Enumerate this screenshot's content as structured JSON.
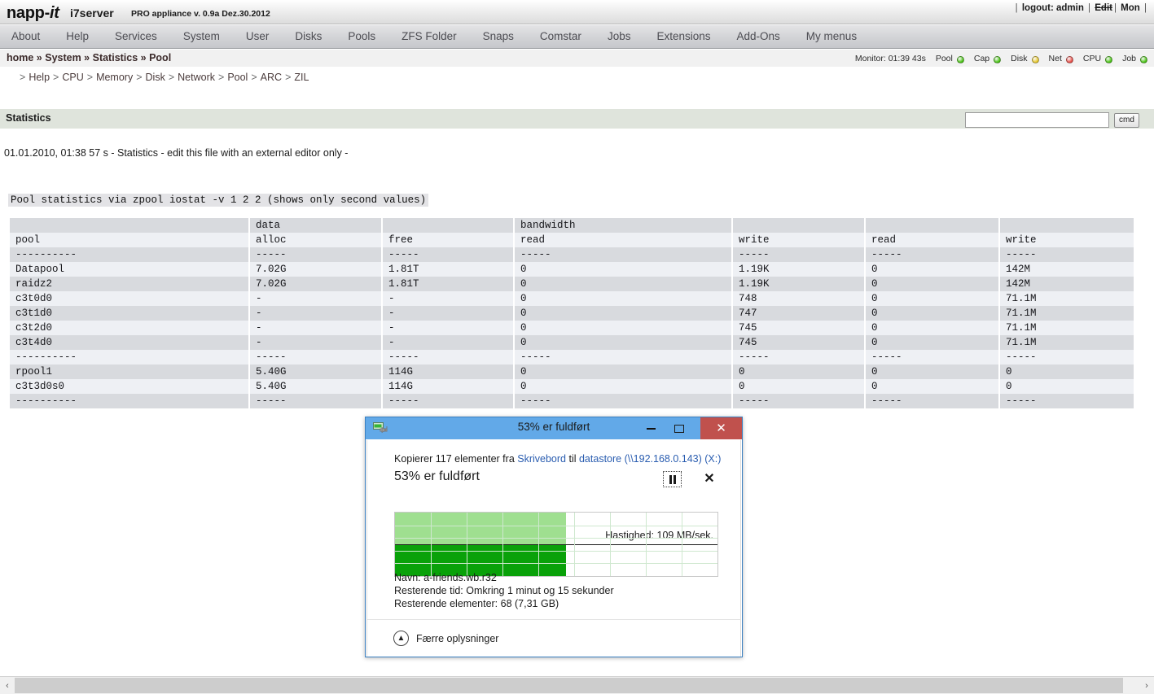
{
  "brand": {
    "logo_napp": "napp-",
    "logo_it": "it",
    "host": "i7server",
    "appliance": "PRO appliance v. 0.9a Dez.30.2012",
    "logout_label": "logout: admin",
    "edit_label": "Edit",
    "day_label": "Mon"
  },
  "menu": {
    "items": [
      {
        "label": "About"
      },
      {
        "label": "Help"
      },
      {
        "label": "Services"
      },
      {
        "label": "System"
      },
      {
        "label": "User"
      },
      {
        "label": "Disks"
      },
      {
        "label": "Pools"
      },
      {
        "label": "ZFS Folder"
      },
      {
        "label": "Snaps"
      },
      {
        "label": "Comstar"
      },
      {
        "label": "Jobs"
      },
      {
        "label": "Extensions"
      },
      {
        "label": "Add-Ons"
      },
      {
        "label": "My menus"
      }
    ]
  },
  "breadcrumb": {
    "text": "home » System » Statistics » Pool"
  },
  "monitor": {
    "label": "Monitor: 01:39 43s",
    "indicators": [
      {
        "name": "Pool",
        "color": "#4cc417"
      },
      {
        "name": "Cap",
        "color": "#4cc417"
      },
      {
        "name": "Disk",
        "color": "#e8c931"
      },
      {
        "name": "Net",
        "color": "#e8504a"
      },
      {
        "name": "CPU",
        "color": "#4cc417"
      },
      {
        "name": "Job",
        "color": "#4cc417"
      }
    ]
  },
  "subnav": {
    "items": [
      {
        "label": "Help"
      },
      {
        "label": "CPU"
      },
      {
        "label": "Memory"
      },
      {
        "label": "Disk"
      },
      {
        "label": "Network"
      },
      {
        "label": "Pool"
      },
      {
        "label": "ARC"
      },
      {
        "label": "ZIL"
      }
    ]
  },
  "section": {
    "title": "Statistics",
    "cmd_value": "",
    "cmd_placeholder": "",
    "cmd_button": "cmd"
  },
  "status": {
    "line": "01.01.2010, 01:38 57 s - Statistics - edit this file with an external editor only -"
  },
  "pool_stats": {
    "caption": "Pool statistics via zpool iostat -v 1 2 2 (shows only second values)",
    "group_headers": [
      "",
      "data",
      "",
      "bandwidth",
      "",
      "",
      ""
    ],
    "column_headers": [
      "pool",
      "alloc",
      "free",
      "read",
      "write",
      "read",
      "write"
    ],
    "separator": [
      "----------",
      "-----",
      "-----",
      "-----",
      "-----",
      "-----",
      "-----"
    ],
    "rows": [
      [
        "Datapool",
        "7.02G",
        "1.81T",
        "0",
        "1.19K",
        "0",
        "142M"
      ],
      [
        "raidz2",
        "7.02G",
        "1.81T",
        "0",
        "1.19K",
        "0",
        "142M"
      ],
      [
        "c3t0d0",
        "-",
        "-",
        "0",
        "748",
        "0",
        "71.1M"
      ],
      [
        "c3t1d0",
        "-",
        "-",
        "0",
        "747",
        "0",
        "71.1M"
      ],
      [
        "c3t2d0",
        "-",
        "-",
        "0",
        "745",
        "0",
        "71.1M"
      ],
      [
        "c3t4d0",
        "-",
        "-",
        "0",
        "745",
        "0",
        "71.1M"
      ],
      [
        "----------",
        "-----",
        "-----",
        "-----",
        "-----",
        "-----",
        "-----"
      ],
      [
        "rpool1",
        "5.40G",
        "114G",
        "0",
        "0",
        "0",
        "0"
      ],
      [
        "c3t3d0s0",
        "5.40G",
        "114G",
        "0",
        "0",
        "0",
        "0"
      ],
      [
        "----------",
        "-----",
        "-----",
        "-----",
        "-----",
        "-----",
        "-----"
      ]
    ]
  },
  "copy_dialog": {
    "title": "53% er fuldført",
    "copying_prefix": "Kopierer 117 elementer fra ",
    "source": "Skrivebord",
    "copying_mid": " til ",
    "destination": "datastore (\\\\192.168.0.143) (X:)",
    "percent_label": "53% er fuldført",
    "percent_value": 53,
    "speed_label": "Hastighed: 109 MB/sek.",
    "name_label": "Navn:",
    "name_value": "a-friends.wb.r32",
    "time_label": "Resterende tid:",
    "time_value": "Omkring 1 minut og 15 sekunder",
    "items_label": "Resterende elementer:",
    "items_value": "68 (7,31 GB)",
    "less_info": "Færre oplysninger",
    "title_accent": "#62a9e8",
    "close_accent": "#c0514d",
    "progress_dark": "#09a109",
    "progress_light": "#9fdf90"
  },
  "scrollbar": {
    "left_arrow": "‹",
    "right_arrow": "›"
  }
}
